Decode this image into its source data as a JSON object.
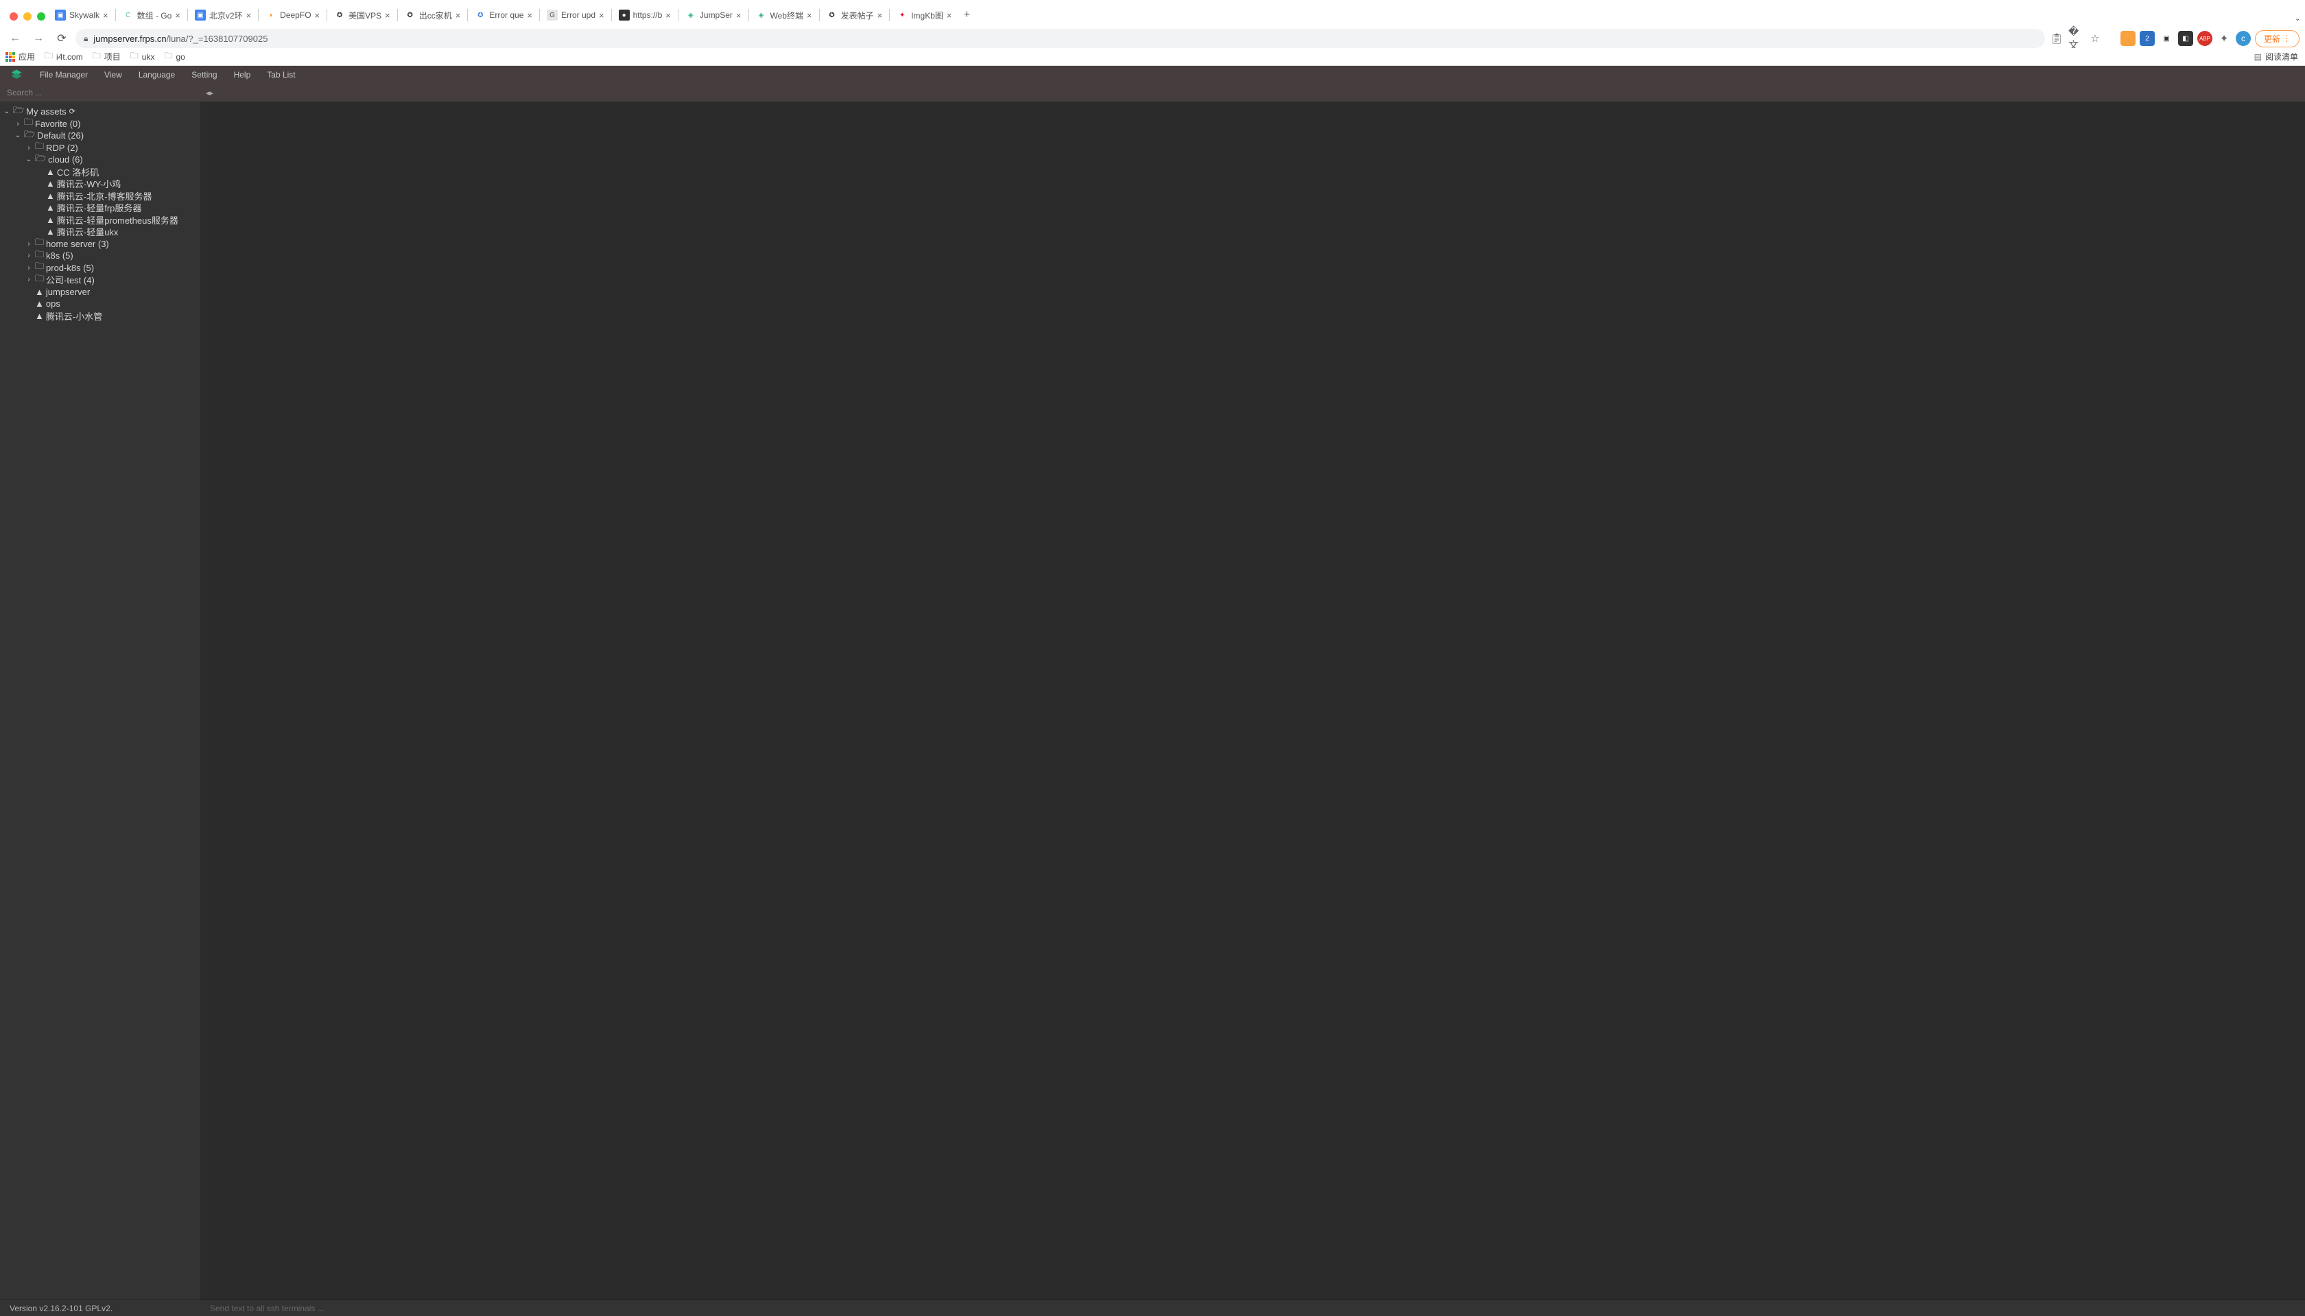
{
  "window": {
    "traffic_lights": [
      "close",
      "minimize",
      "maximize"
    ]
  },
  "browser": {
    "tabs": [
      {
        "title": "Skywalk",
        "favicon_bg": "#4285f4",
        "favicon_char": "▣",
        "favicon_color": "#fff"
      },
      {
        "title": "数组 - Go",
        "favicon_bg": "#fff",
        "favicon_char": "C",
        "favicon_color": "#54bfb0"
      },
      {
        "title": "北京v2环",
        "favicon_bg": "#4285f4",
        "favicon_char": "▣",
        "favicon_color": "#fff"
      },
      {
        "title": "DeepFO",
        "favicon_bg": "#fff",
        "favicon_char": "◗",
        "favicon_color": "#ff8d1a"
      },
      {
        "title": "美国VPS",
        "favicon_bg": "#fff",
        "favicon_char": "✪",
        "favicon_color": "#333"
      },
      {
        "title": "出cc家机",
        "favicon_bg": "#fff",
        "favicon_char": "✪",
        "favicon_color": "#333"
      },
      {
        "title": "Error que",
        "favicon_bg": "#fff",
        "favicon_char": "✪",
        "favicon_color": "#4a7de0"
      },
      {
        "title": "Error upd",
        "favicon_bg": "#e5e5e5",
        "favicon_char": "G",
        "favicon_color": "#555"
      },
      {
        "title": "https://b",
        "favicon_bg": "#333",
        "favicon_char": "●",
        "favicon_color": "#fff"
      },
      {
        "title": "JumpSer",
        "favicon_bg": "#fff",
        "favicon_char": "◈",
        "favicon_color": "#28b07a"
      },
      {
        "title": "Web终端",
        "favicon_bg": "#fff",
        "favicon_char": "◈",
        "favicon_color": "#28b07a",
        "active": true
      },
      {
        "title": "发表帖子",
        "favicon_bg": "#fff",
        "favicon_char": "✪",
        "favicon_color": "#333"
      },
      {
        "title": "ImgKb图",
        "favicon_bg": "#fff",
        "favicon_char": "✦",
        "favicon_color": "#e03"
      }
    ],
    "url_domain": "jumpserver.frps.cn",
    "url_path": "/luna/?_=1638107709025",
    "update_button": "更新",
    "avatar_letter": "c"
  },
  "bookmarks": {
    "apps_label": "应用",
    "items": [
      "i4t.com",
      "项目",
      "ukx",
      "go"
    ],
    "reading_list": "阅读清单"
  },
  "app_menu": {
    "items": [
      "File Manager",
      "View",
      "Language",
      "Setting",
      "Help",
      "Tab List"
    ]
  },
  "search": {
    "placeholder": "Search ..."
  },
  "tree": {
    "root": {
      "label": "My assets",
      "expanded": true
    },
    "favorite": {
      "label": "Favorite",
      "count": "(0)"
    },
    "default": {
      "label": "Default",
      "count": "(26)",
      "expanded": true
    },
    "rdp": {
      "label": "RDP",
      "count": "(2)"
    },
    "cloud": {
      "label": "cloud",
      "count": "(6)",
      "expanded": true,
      "hosts": [
        "CC 洛杉矶",
        "腾讯云-WY-小鸡",
        "腾讯云-北京-博客服务器",
        "腾讯云-轻量frp服务器",
        "腾讯云-轻量prometheus服务器",
        "腾讯云-轻量ukx"
      ]
    },
    "home_server": {
      "label": "home server",
      "count": "(3)"
    },
    "k8s": {
      "label": "k8s",
      "count": "(5)"
    },
    "prod_k8s": {
      "label": "prod-k8s",
      "count": "(5)"
    },
    "company_test": {
      "label": "公司-test",
      "count": "(4)"
    },
    "loose_hosts": [
      "jumpserver",
      "ops",
      "腾讯云-小水管"
    ]
  },
  "main": {
    "collapse_icons": "◂▸"
  },
  "footer": {
    "version": "Version v2.16.2-101 GPLv2.",
    "broadcast_placeholder": "Send text to all ssh terminals ..."
  }
}
